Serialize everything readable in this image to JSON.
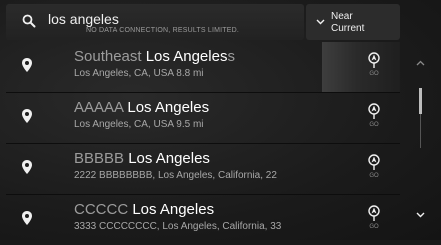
{
  "search": {
    "query": "los angeles",
    "notice": "NO DATA CONNECTION, RESULTS LIMITED."
  },
  "near": {
    "label_line1": "Near",
    "label_line2": "Current"
  },
  "results": [
    {
      "prefix": "Southeast ",
      "name": "Los Angeles",
      "trail": "s",
      "address": "Los Angeles, CA, USA 8.8 mi",
      "go": "GO"
    },
    {
      "prefix": "AAAAA ",
      "name": "Los Angeles",
      "trail": "",
      "address": "Los Angeles, CA, USA 9.5 mi",
      "go": "GO"
    },
    {
      "prefix": "BBBBB ",
      "name": "Los Angeles",
      "trail": "",
      "address": "2222 BBBBBBBB, Los Angeles, California, 22",
      "go": "GO"
    },
    {
      "prefix": "CCCCC ",
      "name": "Los Angeles",
      "trail": "",
      "address": "3333 CCCCCCCC, Los Angeles, California, 33",
      "go": "GO"
    }
  ],
  "icons": {
    "search": "search-icon",
    "pin": "location-pin-icon",
    "go": "navigation-arrow-icon",
    "near": "chevron-down-icon",
    "scroll_up": "chevron-up-icon",
    "scroll_down": "chevron-down-icon"
  }
}
